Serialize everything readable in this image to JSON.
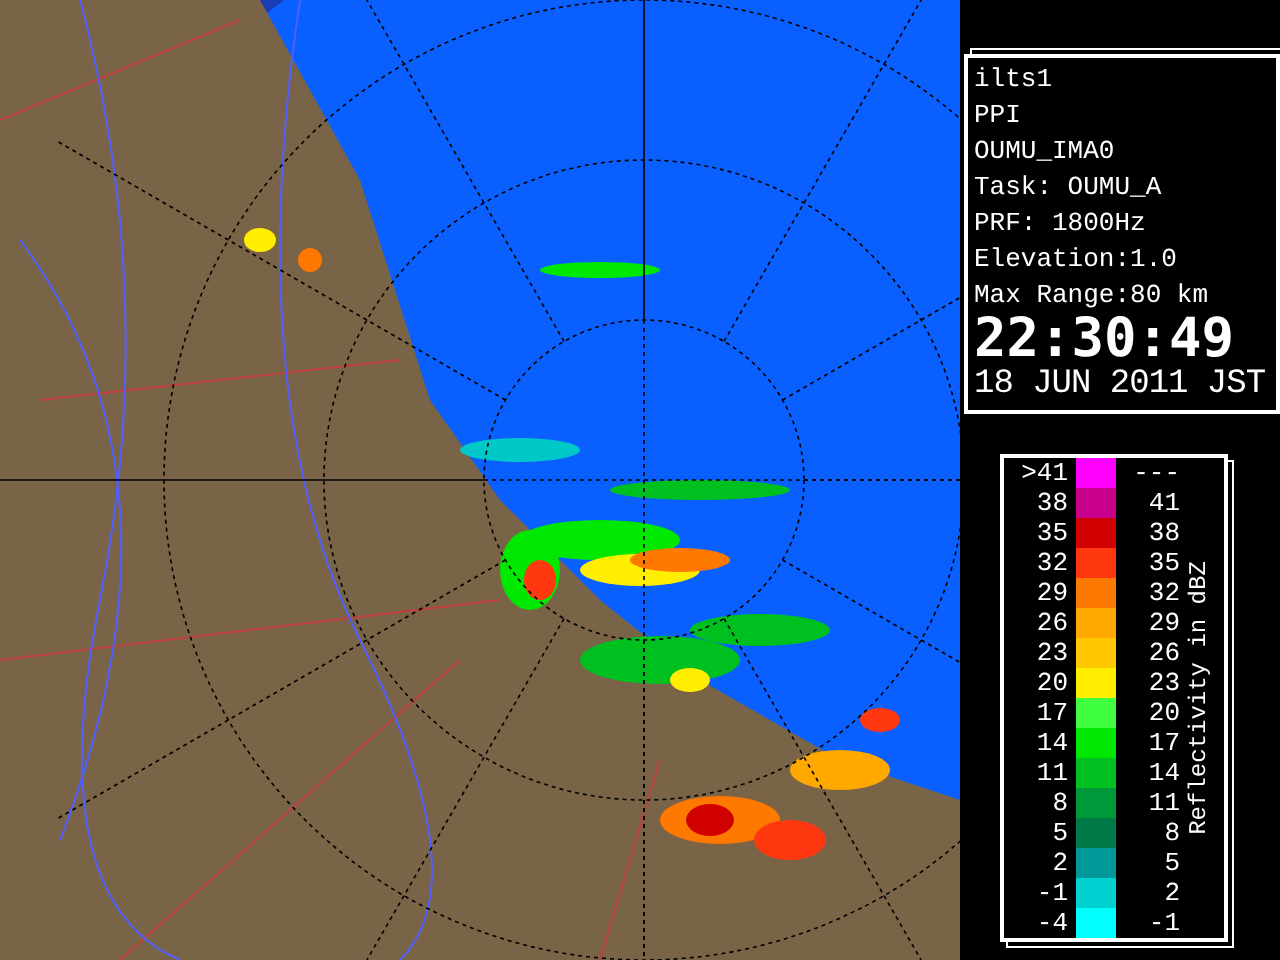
{
  "info_panel": {
    "lines": [
      "ilts1",
      "PPI",
      "OUMU_IMA0",
      "Task: OUMU_A",
      "PRF: 1800Hz",
      "Elevation:1.0",
      "Max Range:80 km"
    ],
    "time": "22:30:49",
    "date": "18 JUN 2011 JST"
  },
  "legend": {
    "title": "Reflectivity in dBZ",
    "rows": [
      {
        "low": ">41",
        "high": "---",
        "color": "#ff00ff"
      },
      {
        "low": "38",
        "high": "41",
        "color": "#c8008c"
      },
      {
        "low": "35",
        "high": "38",
        "color": "#d00000"
      },
      {
        "low": "32",
        "high": "35",
        "color": "#ff3810"
      },
      {
        "low": "29",
        "high": "32",
        "color": "#ff7800"
      },
      {
        "low": "26",
        "high": "29",
        "color": "#ffa800"
      },
      {
        "low": "23",
        "high": "26",
        "color": "#ffc800"
      },
      {
        "low": "20",
        "high": "23",
        "color": "#ffee00"
      },
      {
        "low": "17",
        "high": "20",
        "color": "#40ff40"
      },
      {
        "low": "14",
        "high": "17",
        "color": "#00e800"
      },
      {
        "low": "11",
        "high": "14",
        "color": "#00c020"
      },
      {
        "low": "8",
        "high": "11",
        "color": "#009838"
      },
      {
        "low": "5",
        "high": "8",
        "color": "#007848"
      },
      {
        "low": "2",
        "high": "5",
        "color": "#009898"
      },
      {
        "low": "-1",
        "high": "2",
        "color": "#00d0d0"
      },
      {
        "low": "-4",
        "high": "-1",
        "color": "#00ffff"
      }
    ]
  }
}
